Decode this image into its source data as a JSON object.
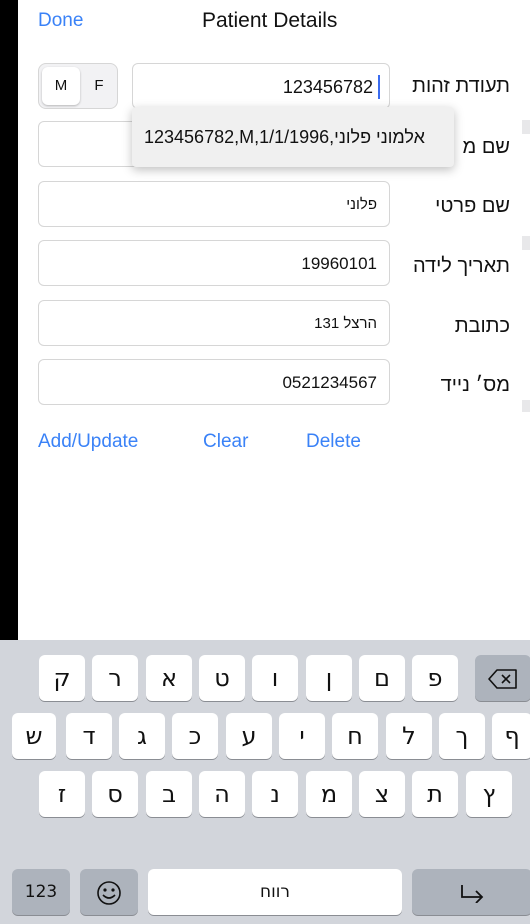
{
  "nav": {
    "done": "Done",
    "title": "Patient Details"
  },
  "gender": {
    "m": "M",
    "f": "F"
  },
  "fields": {
    "id_label": "תעודת זהות",
    "id_value": "123456782",
    "last_name_label": "שם מ",
    "first_name_label": "שם פרטי",
    "first_name_value": "פלוני",
    "dob_label": "תאריך לידה",
    "dob_value": "19960101",
    "address_label": "כתובת",
    "address_value": "הרצל 131",
    "phone_label": "מס׳ נייד",
    "phone_value": "0521234567"
  },
  "autocomplete": {
    "suggestion": "123456782,M,1/1/1996,אלמוני פלוני"
  },
  "actions": {
    "add_update": "Add/Update",
    "clear": "Clear",
    "delete": "Delete"
  },
  "keyboard": {
    "row1": [
      "ק",
      "ר",
      "א",
      "ט",
      "ו",
      "ן",
      "ם",
      "פ"
    ],
    "row2": [
      "ש",
      "ד",
      "ג",
      "כ",
      "ע",
      "י",
      "ח",
      "ל",
      "ך",
      "ף"
    ],
    "row3": [
      "ז",
      "ס",
      "ב",
      "ה",
      "נ",
      "מ",
      "צ",
      "ת",
      "ץ"
    ],
    "numbers": "123",
    "space": "רווח",
    "icons": {
      "backspace": "backspace-icon",
      "emoji": "emoji-icon",
      "return": "return-icon"
    }
  },
  "colors": {
    "accent": "#3a82f7",
    "caret": "#3a6cf0",
    "keyboard_bg": "#d2d5db"
  }
}
